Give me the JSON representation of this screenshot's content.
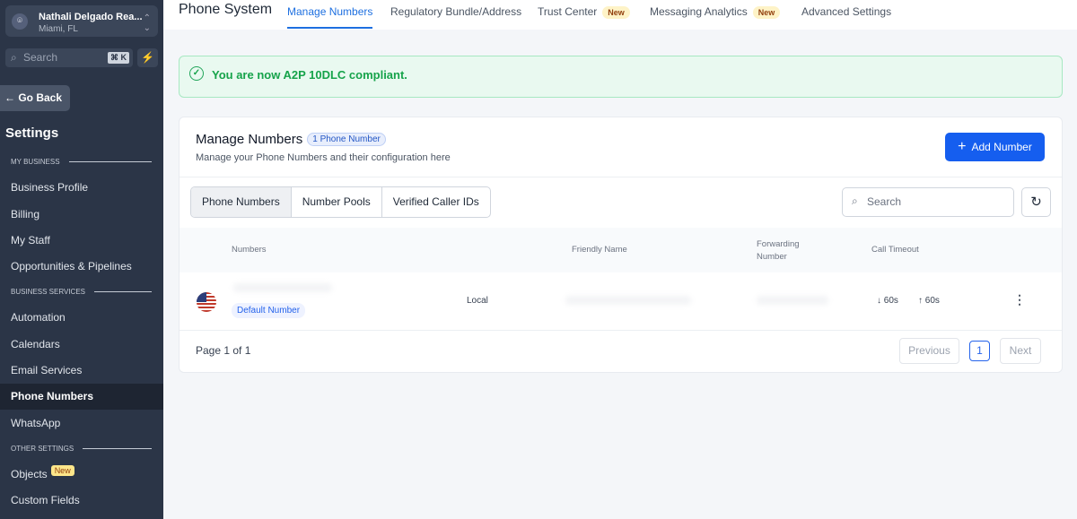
{
  "account": {
    "name": "Nathali Delgado Rea...",
    "location": "Miami, FL"
  },
  "search": {
    "placeholder": "Search",
    "shortcut": "⌘ K"
  },
  "sidebar": {
    "back": "← Go Back",
    "title": "Settings",
    "sections": [
      "MY BUSINESS",
      "BUSINESS SERVICES",
      "OTHER SETTINGS"
    ],
    "items": [
      "Business Profile",
      "Billing",
      "My Staff",
      "Opportunities & Pipelines",
      "Automation",
      "Calendars",
      "Email Services",
      "Phone Numbers",
      "WhatsApp",
      "Objects",
      "Custom Fields"
    ],
    "new_badge": "New"
  },
  "header": {
    "title": "Phone System",
    "tabs": [
      "Manage Numbers",
      "Regulatory Bundle/Address",
      "Trust Center",
      "Messaging Analytics",
      "Advanced Settings"
    ],
    "new_badge": "New"
  },
  "banner": "You are now A2P 10DLC compliant.",
  "card": {
    "title": "Manage Numbers",
    "count": "1 Phone Number",
    "subtitle": "Manage your Phone Numbers and their configuration here",
    "add": "Add Number",
    "segments": [
      "Phone Numbers",
      "Number Pools",
      "Verified Caller IDs"
    ],
    "search_placeholder": "Search",
    "columns": [
      "Numbers",
      "Friendly Name",
      "Forwarding Number",
      "Call Timeout"
    ],
    "row": {
      "badge": "Default Number",
      "type": "Local",
      "timeout_in": "↓ 60s",
      "timeout_out": "↑ 60s"
    },
    "pagination": {
      "label": "Page 1 of 1",
      "prev": "Previous",
      "page": "1",
      "next": "Next"
    }
  }
}
